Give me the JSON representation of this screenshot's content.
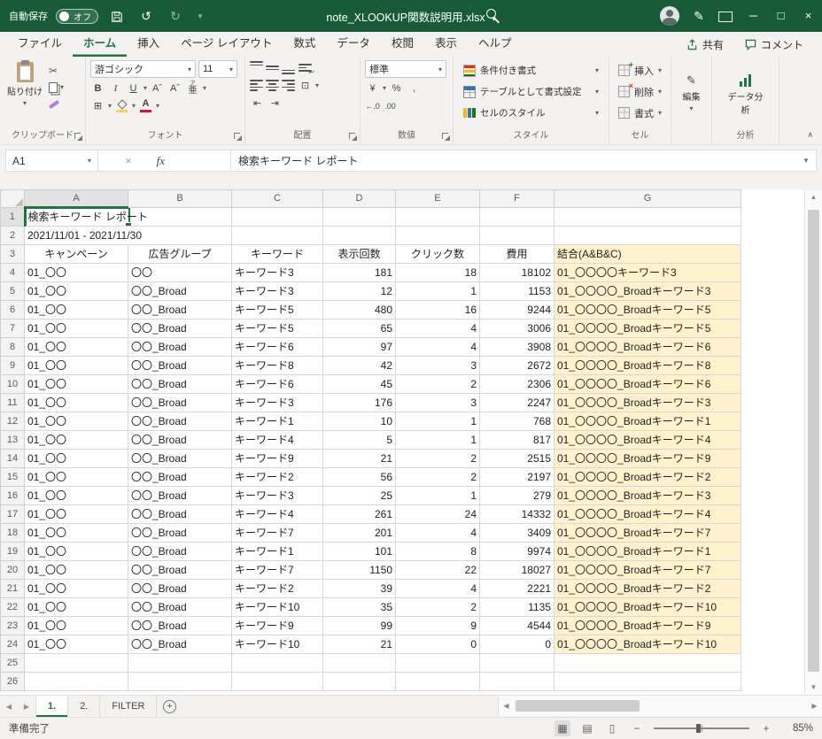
{
  "titlebar": {
    "autosave_label": "自動保存",
    "autosave_state": "オフ",
    "filename": "note_XLOOKUP関数説明用.xlsx"
  },
  "ribbon_tabs": {
    "tabs": [
      "ファイル",
      "ホーム",
      "挿入",
      "ページ レイアウト",
      "数式",
      "データ",
      "校閲",
      "表示",
      "ヘルプ"
    ],
    "active": "ホーム",
    "share": "共有",
    "comments": "コメント"
  },
  "ribbon": {
    "paste": "貼り付け",
    "font_name": "游ゴシック",
    "font_size": "11",
    "number_format": "標準",
    "conditional_formatting": "条件付き書式",
    "format_as_table": "テーブルとして書式設定",
    "cell_styles": "セルのスタイル",
    "insert": "挿入",
    "delete": "削除",
    "format": "書式",
    "edit": "編集",
    "data_analysis": "データ分析",
    "groups": {
      "clipboard": "クリップボード",
      "font": "フォント",
      "alignment": "配置",
      "number": "数値",
      "styles": "スタイル",
      "cells": "セル",
      "analysis": "分析"
    }
  },
  "formula_bar": {
    "name_box": "A1",
    "fx_label": "fx",
    "value": "検索キーワード レポート"
  },
  "grid": {
    "column_headers": [
      "A",
      "B",
      "C",
      "D",
      "E",
      "F",
      "G"
    ],
    "row_count": 26,
    "title_cell": "検索キーワード レポート",
    "date_range": "2021/11/01 - 2021/11/30",
    "table_headers": [
      "キャンペーン",
      "広告グループ",
      "キーワード",
      "表示回数",
      "クリック数",
      "費用",
      "結合(A&B&C)"
    ],
    "rows": [
      [
        "01_〇〇",
        "〇〇",
        "キーワード3",
        181,
        18,
        18102,
        "01_〇〇〇〇キーワード3"
      ],
      [
        "01_〇〇",
        "〇〇_Broad",
        "キーワード3",
        12,
        1,
        1153,
        "01_〇〇〇〇_Broadキーワード3"
      ],
      [
        "01_〇〇",
        "〇〇_Broad",
        "キーワード5",
        480,
        16,
        9244,
        "01_〇〇〇〇_Broadキーワード5"
      ],
      [
        "01_〇〇",
        "〇〇_Broad",
        "キーワード5",
        65,
        4,
        3006,
        "01_〇〇〇〇_Broadキーワード5"
      ],
      [
        "01_〇〇",
        "〇〇_Broad",
        "キーワード6",
        97,
        4,
        3908,
        "01_〇〇〇〇_Broadキーワード6"
      ],
      [
        "01_〇〇",
        "〇〇_Broad",
        "キーワード8",
        42,
        3,
        2672,
        "01_〇〇〇〇_Broadキーワード8"
      ],
      [
        "01_〇〇",
        "〇〇_Broad",
        "キーワード6",
        45,
        2,
        2306,
        "01_〇〇〇〇_Broadキーワード6"
      ],
      [
        "01_〇〇",
        "〇〇_Broad",
        "キーワード3",
        176,
        3,
        2247,
        "01_〇〇〇〇_Broadキーワード3"
      ],
      [
        "01_〇〇",
        "〇〇_Broad",
        "キーワード1",
        10,
        1,
        768,
        "01_〇〇〇〇_Broadキーワード1"
      ],
      [
        "01_〇〇",
        "〇〇_Broad",
        "キーワード4",
        5,
        1,
        817,
        "01_〇〇〇〇_Broadキーワード4"
      ],
      [
        "01_〇〇",
        "〇〇_Broad",
        "キーワード9",
        21,
        2,
        2515,
        "01_〇〇〇〇_Broadキーワード9"
      ],
      [
        "01_〇〇",
        "〇〇_Broad",
        "キーワード2",
        56,
        2,
        2197,
        "01_〇〇〇〇_Broadキーワード2"
      ],
      [
        "01_〇〇",
        "〇〇_Broad",
        "キーワード3",
        25,
        1,
        279,
        "01_〇〇〇〇_Broadキーワード3"
      ],
      [
        "01_〇〇",
        "〇〇_Broad",
        "キーワード4",
        261,
        24,
        14332,
        "01_〇〇〇〇_Broadキーワード4"
      ],
      [
        "01_〇〇",
        "〇〇_Broad",
        "キーワード7",
        201,
        4,
        3409,
        "01_〇〇〇〇_Broadキーワード7"
      ],
      [
        "01_〇〇",
        "〇〇_Broad",
        "キーワード1",
        101,
        8,
        9974,
        "01_〇〇〇〇_Broadキーワード1"
      ],
      [
        "01_〇〇",
        "〇〇_Broad",
        "キーワード7",
        1150,
        22,
        18027,
        "01_〇〇〇〇_Broadキーワード7"
      ],
      [
        "01_〇〇",
        "〇〇_Broad",
        "キーワード2",
        39,
        4,
        2221,
        "01_〇〇〇〇_Broadキーワード2"
      ],
      [
        "01_〇〇",
        "〇〇_Broad",
        "キーワード10",
        35,
        2,
        1135,
        "01_〇〇〇〇_Broadキーワード10"
      ],
      [
        "01_〇〇",
        "〇〇_Broad",
        "キーワード9",
        99,
        9,
        4544,
        "01_〇〇〇〇_Broadキーワード9"
      ],
      [
        "01_〇〇",
        "〇〇_Broad",
        "キーワード10",
        21,
        0,
        0,
        "01_〇〇〇〇_Broadキーワード10"
      ]
    ]
  },
  "sheet_tabs": {
    "tabs": [
      "1.",
      "2.",
      "FILTER"
    ],
    "active": "1."
  },
  "status_bar": {
    "ready": "準備完了",
    "zoom": "85%"
  },
  "colors": {
    "titlebar": "#185C37",
    "accent": "#217346",
    "highlight_fill": "#FFF2CC"
  },
  "icons": {
    "dropdown": "▾",
    "undo": "↺",
    "redo": "↻",
    "minimize": "─",
    "maximize": "□",
    "close": "×",
    "pen": "✎",
    "scissors": "✂",
    "bold": "B",
    "italic": "I",
    "underline": "U",
    "font_grow": "Aˆ",
    "font_shrink": "Aˇ",
    "font_color_letter": "A",
    "ruby_top": "ア",
    "ruby_base": "亜",
    "borders": "⊞",
    "merge": "⊡",
    "currency": "¥",
    "percent": "%",
    "comma": ",",
    "inc_decimal": "←.0",
    "dec_decimal": ".00",
    "wrap_arrow": "↩",
    "outdent": "⇤",
    "indent": "⇥",
    "plus": "+",
    "cross": "×",
    "collapse": "∧",
    "cancel": "×",
    "nav_left": "◀",
    "nav_right": "▶",
    "scroll_up": "▲",
    "scroll_down": "▼",
    "view_normal": "▦",
    "view_layout": "▤",
    "view_break": "▯",
    "zoom_out": "−",
    "zoom_in": "+"
  }
}
